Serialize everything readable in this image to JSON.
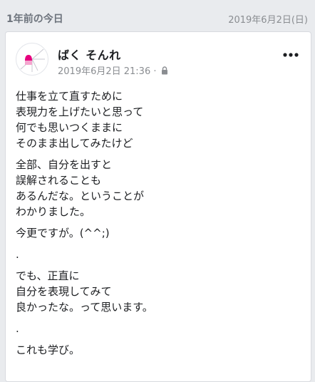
{
  "memory": {
    "title": "1年前の今日",
    "date": "2019年6月2日(日)"
  },
  "post": {
    "author": "ばく そんれ",
    "timestamp": "2019年6月2日 21:36 ·",
    "privacy_icon": "lock-icon",
    "more_icon": "more-horizontal-icon",
    "paragraphs": [
      [
        "仕事を立て直すために",
        "表現力を上げたいと思って",
        "何でも思いつくままに",
        "そのまま出してみたけど"
      ],
      [
        "全部、自分を出すと",
        "誤解されることも",
        "あるんだな。ということが",
        "わかりました。"
      ],
      [
        "今更ですが。(^^;)"
      ],
      [
        "."
      ],
      [
        "でも、正直に",
        "自分を表現してみて",
        "良かったな。って思います。"
      ],
      [
        "."
      ],
      [
        "これも学び。"
      ]
    ]
  },
  "colors": {
    "background": "#e9ebee",
    "card": "#ffffff",
    "text": "#1c1e21",
    "muted": "#8a8d91",
    "avatar_accent": "#e6007e"
  }
}
